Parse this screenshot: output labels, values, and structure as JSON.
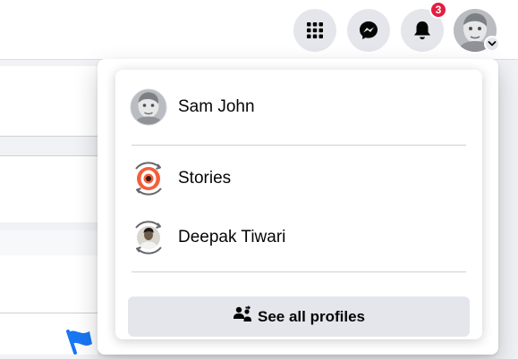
{
  "header": {
    "menu_icon": "grid-menu-icon",
    "messenger_icon": "messenger-icon",
    "notifications_icon": "bell-icon",
    "notification_count": "3",
    "account_icon": "chevron-down-icon"
  },
  "menu": {
    "main_profile": {
      "name": "Sam John",
      "icon": "avatar"
    },
    "profiles": [
      {
        "name": "Stories",
        "icon": "stories-avatar"
      },
      {
        "name": "Deepak Tiwari",
        "icon": "person-avatar"
      }
    ],
    "see_all": {
      "label": "See all profiles",
      "icon": "profiles-switch-icon"
    }
  },
  "colors": {
    "badge": "#e41e3f",
    "button_bg": "#e4e6eb",
    "menu_bg": "#ffffff",
    "page_bg": "#f0f2f5",
    "flag": "#1877f2"
  }
}
